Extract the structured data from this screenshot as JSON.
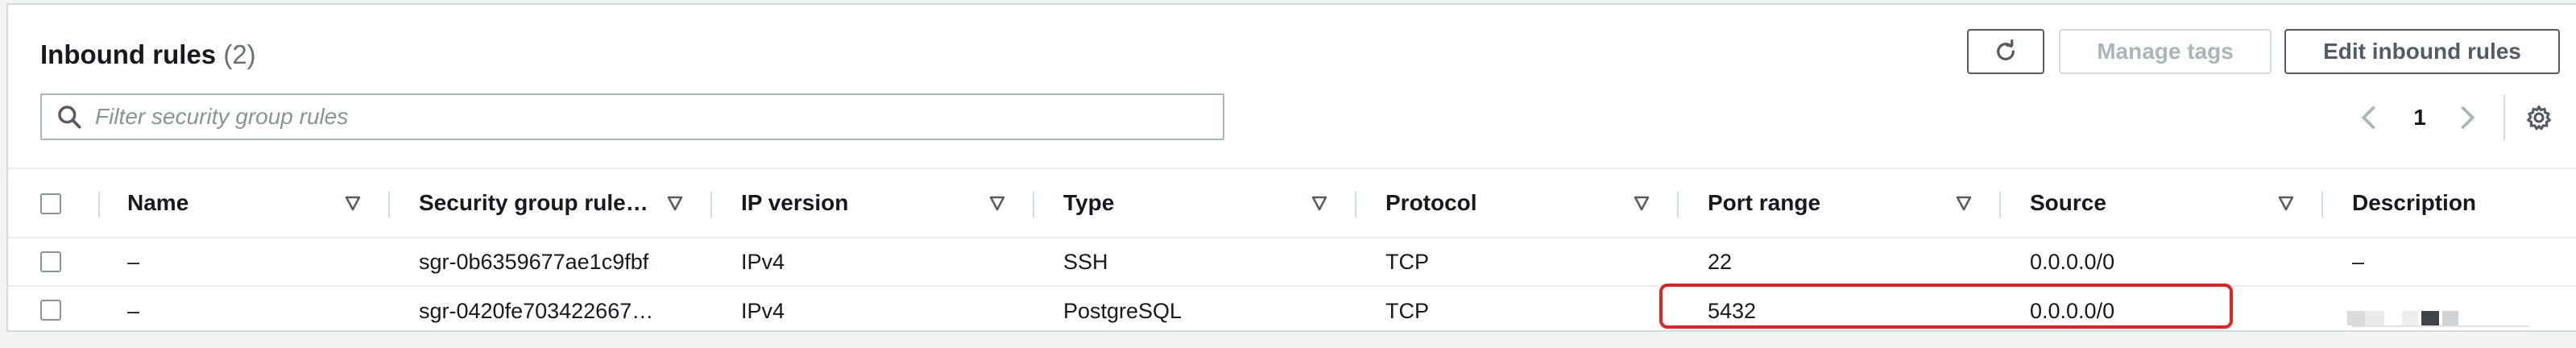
{
  "header": {
    "title": "Inbound rules",
    "count": "(2)",
    "manage_tags_label": "Manage tags",
    "edit_inbound_label": "Edit inbound rules"
  },
  "search": {
    "placeholder": "Filter security group rules",
    "value": ""
  },
  "pagination": {
    "current_page": "1"
  },
  "table": {
    "columns": [
      "Name",
      "Security group rule…",
      "IP version",
      "Type",
      "Protocol",
      "Port range",
      "Source",
      "Description"
    ],
    "rows": [
      {
        "name": "–",
        "rule_id": "sgr-0b6359677ae1c9fbf",
        "ip_version": "IPv4",
        "type": "SSH",
        "protocol": "TCP",
        "port_range": "22",
        "source": "0.0.0.0/0",
        "description": "–"
      },
      {
        "name": "–",
        "rule_id": "sgr-0420fe703422667…",
        "ip_version": "IPv4",
        "type": "PostgreSQL",
        "protocol": "TCP",
        "port_range": "5432",
        "source": "0.0.0.0/0",
        "description": ""
      }
    ]
  },
  "icons": {
    "refresh": "refresh-icon",
    "search": "search-icon",
    "prev": "chevron-left-icon",
    "next": "chevron-right-icon",
    "settings": "gear-icon",
    "sort": "sort-triangle-icon"
  },
  "colors": {
    "text": "#16191f",
    "muted": "#687078",
    "disabled": "#aab7b8",
    "border": "#d5dbdb",
    "highlight": "#e02424"
  }
}
